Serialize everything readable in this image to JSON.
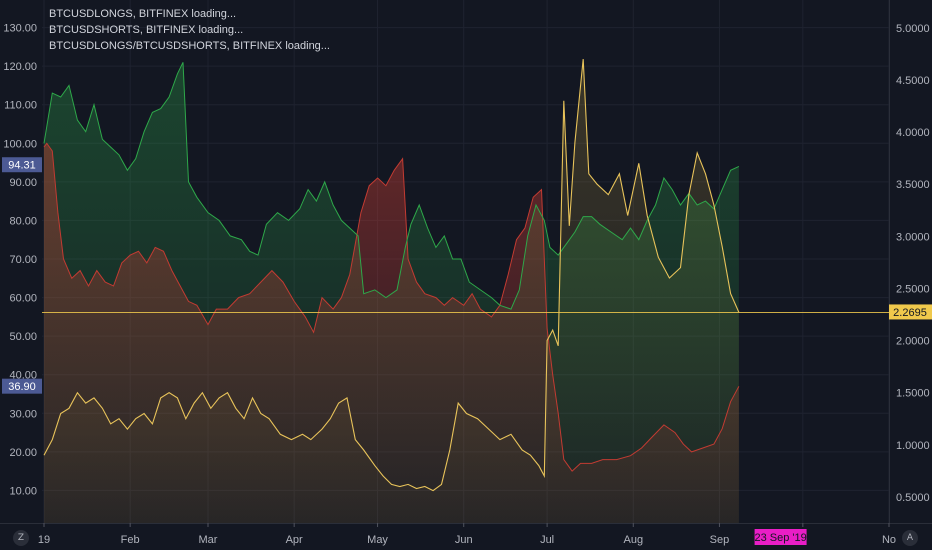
{
  "legend": [
    "BTCUSDLONGS, BITFINEX loading...",
    "BTCUSDSHORTS, BITFINEX loading...",
    "BTCUSDLONGS/BTCUSDSHORTS, BITFINEX loading..."
  ],
  "controls": {
    "left_button": "Z",
    "right_button": "A"
  },
  "colors": {
    "background": "#131722",
    "long_green": "#2ea84a",
    "short_red": "#c23b32",
    "ratio_yellow": "#e8c35a",
    "left_badge": "#4c5a94",
    "right_badge": "#f0c94c",
    "date_badge": "#e91ec6"
  },
  "chart_data": {
    "type": "area",
    "left_axis": {
      "ticks": [
        "130.00",
        "120.00",
        "110.00",
        "100.00",
        "90.00",
        "80.00",
        "70.00",
        "60.00",
        "50.00",
        "40.00",
        "30.00",
        "20.00",
        "10.00"
      ],
      "min": 0,
      "max": 133
    },
    "right_axis": {
      "ticks": [
        "5.0000",
        "4.5000",
        "4.0000",
        "3.5000",
        "3.0000",
        "2.5000",
        "2.0000",
        "1.5000",
        "1.0000",
        "0.5000"
      ],
      "min": 0,
      "max": 5.2
    },
    "x_labels": [
      "19",
      "Feb",
      "Mar",
      "Apr",
      "May",
      "Jun",
      "Jul",
      "Aug",
      "Sep",
      "t",
      "No"
    ],
    "x_dates": [
      "2019-01-01",
      "2019-02-01",
      "2019-03-01",
      "2019-04-01",
      "2019-05-01",
      "2019-06-01",
      "2019-07-01",
      "2019-08-01",
      "2019-09-01",
      "2019-10-01",
      "2019-11-01"
    ],
    "x_range": [
      "2019-01-01",
      "2019-11-01"
    ],
    "crosshair": {
      "date_label": "23 Sep '19",
      "date": "2019-09-23",
      "value_label": "2.2695",
      "value": 2.2695
    },
    "last_value_labels": {
      "longs": "94.31",
      "shorts": "36.90"
    },
    "series": [
      {
        "name": "BTCUSDLONGS",
        "axis": "left",
        "color": "#2ea84a",
        "points": [
          [
            "2019-01-01",
            100
          ],
          [
            "2019-01-04",
            113
          ],
          [
            "2019-01-07",
            112
          ],
          [
            "2019-01-10",
            115
          ],
          [
            "2019-01-13",
            106
          ],
          [
            "2019-01-16",
            103
          ],
          [
            "2019-01-19",
            110
          ],
          [
            "2019-01-22",
            101
          ],
          [
            "2019-01-25",
            99
          ],
          [
            "2019-01-28",
            97
          ],
          [
            "2019-01-31",
            93
          ],
          [
            "2019-02-03",
            96
          ],
          [
            "2019-02-06",
            103
          ],
          [
            "2019-02-09",
            108
          ],
          [
            "2019-02-12",
            109
          ],
          [
            "2019-02-15",
            112
          ],
          [
            "2019-02-18",
            118
          ],
          [
            "2019-02-20",
            121
          ],
          [
            "2019-02-22",
            90
          ],
          [
            "2019-02-25",
            86
          ],
          [
            "2019-03-01",
            82
          ],
          [
            "2019-03-05",
            80
          ],
          [
            "2019-03-09",
            76
          ],
          [
            "2019-03-13",
            75
          ],
          [
            "2019-03-16",
            72
          ],
          [
            "2019-03-19",
            71
          ],
          [
            "2019-03-22",
            79
          ],
          [
            "2019-03-26",
            82
          ],
          [
            "2019-03-30",
            80
          ],
          [
            "2019-04-03",
            83
          ],
          [
            "2019-04-06",
            88
          ],
          [
            "2019-04-09",
            85
          ],
          [
            "2019-04-12",
            90
          ],
          [
            "2019-04-15",
            84
          ],
          [
            "2019-04-18",
            80
          ],
          [
            "2019-04-21",
            78
          ],
          [
            "2019-04-24",
            76
          ],
          [
            "2019-04-26",
            61
          ],
          [
            "2019-04-30",
            62
          ],
          [
            "2019-05-04",
            60
          ],
          [
            "2019-05-08",
            62
          ],
          [
            "2019-05-11",
            73
          ],
          [
            "2019-05-13",
            79
          ],
          [
            "2019-05-16",
            84
          ],
          [
            "2019-05-19",
            78
          ],
          [
            "2019-05-22",
            73
          ],
          [
            "2019-05-25",
            76
          ],
          [
            "2019-05-28",
            70
          ],
          [
            "2019-05-31",
            70
          ],
          [
            "2019-06-03",
            64
          ],
          [
            "2019-06-07",
            62
          ],
          [
            "2019-06-11",
            60
          ],
          [
            "2019-06-14",
            58
          ],
          [
            "2019-06-18",
            57
          ],
          [
            "2019-06-21",
            62
          ],
          [
            "2019-06-24",
            76
          ],
          [
            "2019-06-27",
            84
          ],
          [
            "2019-06-30",
            80
          ],
          [
            "2019-07-02",
            73
          ],
          [
            "2019-07-05",
            71
          ],
          [
            "2019-07-08",
            74
          ],
          [
            "2019-07-11",
            77
          ],
          [
            "2019-07-14",
            81
          ],
          [
            "2019-07-17",
            81
          ],
          [
            "2019-07-20",
            79
          ],
          [
            "2019-07-24",
            77
          ],
          [
            "2019-07-28",
            75
          ],
          [
            "2019-07-31",
            78
          ],
          [
            "2019-08-03",
            75
          ],
          [
            "2019-08-06",
            80
          ],
          [
            "2019-08-09",
            84
          ],
          [
            "2019-08-12",
            91
          ],
          [
            "2019-08-15",
            88
          ],
          [
            "2019-08-18",
            84
          ],
          [
            "2019-08-21",
            87
          ],
          [
            "2019-08-24",
            84
          ],
          [
            "2019-08-27",
            85
          ],
          [
            "2019-08-30",
            83
          ],
          [
            "2019-09-02",
            88
          ],
          [
            "2019-09-05",
            93
          ],
          [
            "2019-09-08",
            94
          ]
        ]
      },
      {
        "name": "BTCUSDSHORTS",
        "axis": "left",
        "color": "#c23b32",
        "points": [
          [
            "2019-01-01",
            99
          ],
          [
            "2019-01-02",
            100
          ],
          [
            "2019-01-04",
            98
          ],
          [
            "2019-01-06",
            82
          ],
          [
            "2019-01-08",
            70
          ],
          [
            "2019-01-11",
            65
          ],
          [
            "2019-01-14",
            67
          ],
          [
            "2019-01-17",
            63
          ],
          [
            "2019-01-20",
            67
          ],
          [
            "2019-01-23",
            64
          ],
          [
            "2019-01-26",
            63
          ],
          [
            "2019-01-29",
            69
          ],
          [
            "2019-02-01",
            71
          ],
          [
            "2019-02-04",
            72
          ],
          [
            "2019-02-07",
            69
          ],
          [
            "2019-02-10",
            73
          ],
          [
            "2019-02-13",
            72
          ],
          [
            "2019-02-16",
            67
          ],
          [
            "2019-02-19",
            63
          ],
          [
            "2019-02-22",
            59
          ],
          [
            "2019-02-25",
            58
          ],
          [
            "2019-03-01",
            53
          ],
          [
            "2019-03-04",
            57
          ],
          [
            "2019-03-08",
            57
          ],
          [
            "2019-03-12",
            60
          ],
          [
            "2019-03-16",
            61
          ],
          [
            "2019-03-20",
            64
          ],
          [
            "2019-03-24",
            67
          ],
          [
            "2019-03-28",
            64
          ],
          [
            "2019-04-01",
            59
          ],
          [
            "2019-04-05",
            55
          ],
          [
            "2019-04-08",
            51
          ],
          [
            "2019-04-11",
            60
          ],
          [
            "2019-04-15",
            57
          ],
          [
            "2019-04-18",
            60
          ],
          [
            "2019-04-21",
            66
          ],
          [
            "2019-04-25",
            82
          ],
          [
            "2019-04-28",
            89
          ],
          [
            "2019-05-01",
            91
          ],
          [
            "2019-05-04",
            89
          ],
          [
            "2019-05-07",
            93
          ],
          [
            "2019-05-10",
            96
          ],
          [
            "2019-05-12",
            70
          ],
          [
            "2019-05-15",
            64
          ],
          [
            "2019-05-18",
            61
          ],
          [
            "2019-05-22",
            60
          ],
          [
            "2019-05-25",
            58
          ],
          [
            "2019-05-28",
            60
          ],
          [
            "2019-06-01",
            58
          ],
          [
            "2019-06-04",
            61
          ],
          [
            "2019-06-07",
            57
          ],
          [
            "2019-06-11",
            55
          ],
          [
            "2019-06-14",
            58
          ],
          [
            "2019-06-17",
            66
          ],
          [
            "2019-06-20",
            75
          ],
          [
            "2019-06-23",
            78
          ],
          [
            "2019-06-26",
            86
          ],
          [
            "2019-06-29",
            88
          ],
          [
            "2019-07-01",
            52
          ],
          [
            "2019-07-03",
            40
          ],
          [
            "2019-07-05",
            30
          ],
          [
            "2019-07-07",
            18
          ],
          [
            "2019-07-10",
            15
          ],
          [
            "2019-07-13",
            17
          ],
          [
            "2019-07-17",
            17
          ],
          [
            "2019-07-21",
            18
          ],
          [
            "2019-07-26",
            18
          ],
          [
            "2019-07-31",
            19
          ],
          [
            "2019-08-04",
            21
          ],
          [
            "2019-08-08",
            24
          ],
          [
            "2019-08-12",
            27
          ],
          [
            "2019-08-16",
            25
          ],
          [
            "2019-08-19",
            22
          ],
          [
            "2019-08-22",
            20
          ],
          [
            "2019-08-26",
            21
          ],
          [
            "2019-08-30",
            22
          ],
          [
            "2019-09-02",
            26
          ],
          [
            "2019-09-05",
            33
          ],
          [
            "2019-09-08",
            37
          ]
        ]
      },
      {
        "name": "BTCUSDLONGS/BTCUSDSHORTS",
        "axis": "right",
        "color": "#e8c35a",
        "points": [
          [
            "2019-01-01",
            0.9
          ],
          [
            "2019-01-04",
            1.05
          ],
          [
            "2019-01-07",
            1.3
          ],
          [
            "2019-01-10",
            1.35
          ],
          [
            "2019-01-13",
            1.5
          ],
          [
            "2019-01-16",
            1.4
          ],
          [
            "2019-01-19",
            1.45
          ],
          [
            "2019-01-22",
            1.35
          ],
          [
            "2019-01-25",
            1.2
          ],
          [
            "2019-01-28",
            1.25
          ],
          [
            "2019-01-31",
            1.15
          ],
          [
            "2019-02-03",
            1.25
          ],
          [
            "2019-02-06",
            1.3
          ],
          [
            "2019-02-09",
            1.2
          ],
          [
            "2019-02-12",
            1.45
          ],
          [
            "2019-02-15",
            1.5
          ],
          [
            "2019-02-18",
            1.45
          ],
          [
            "2019-02-21",
            1.25
          ],
          [
            "2019-02-24",
            1.4
          ],
          [
            "2019-02-27",
            1.5
          ],
          [
            "2019-03-02",
            1.35
          ],
          [
            "2019-03-05",
            1.45
          ],
          [
            "2019-03-08",
            1.5
          ],
          [
            "2019-03-11",
            1.35
          ],
          [
            "2019-03-14",
            1.25
          ],
          [
            "2019-03-17",
            1.45
          ],
          [
            "2019-03-20",
            1.3
          ],
          [
            "2019-03-23",
            1.25
          ],
          [
            "2019-03-27",
            1.1
          ],
          [
            "2019-03-31",
            1.05
          ],
          [
            "2019-04-04",
            1.1
          ],
          [
            "2019-04-07",
            1.05
          ],
          [
            "2019-04-11",
            1.15
          ],
          [
            "2019-04-14",
            1.25
          ],
          [
            "2019-04-17",
            1.4
          ],
          [
            "2019-04-20",
            1.45
          ],
          [
            "2019-04-23",
            1.05
          ],
          [
            "2019-04-26",
            0.95
          ],
          [
            "2019-04-30",
            0.8
          ],
          [
            "2019-05-03",
            0.7
          ],
          [
            "2019-05-06",
            0.62
          ],
          [
            "2019-05-09",
            0.6
          ],
          [
            "2019-05-12",
            0.62
          ],
          [
            "2019-05-15",
            0.58
          ],
          [
            "2019-05-18",
            0.6
          ],
          [
            "2019-05-21",
            0.56
          ],
          [
            "2019-05-24",
            0.62
          ],
          [
            "2019-05-27",
            0.95
          ],
          [
            "2019-05-30",
            1.4
          ],
          [
            "2019-06-02",
            1.3
          ],
          [
            "2019-06-06",
            1.25
          ],
          [
            "2019-06-10",
            1.15
          ],
          [
            "2019-06-14",
            1.05
          ],
          [
            "2019-06-18",
            1.1
          ],
          [
            "2019-06-22",
            0.95
          ],
          [
            "2019-06-25",
            0.9
          ],
          [
            "2019-06-28",
            0.8
          ],
          [
            "2019-06-30",
            0.7
          ],
          [
            "2019-07-01",
            2.0
          ],
          [
            "2019-07-03",
            2.1
          ],
          [
            "2019-07-05",
            1.95
          ],
          [
            "2019-07-07",
            4.3
          ],
          [
            "2019-07-09",
            3.1
          ],
          [
            "2019-07-11",
            3.9
          ],
          [
            "2019-07-14",
            4.7
          ],
          [
            "2019-07-16",
            3.6
          ],
          [
            "2019-07-19",
            3.5
          ],
          [
            "2019-07-23",
            3.4
          ],
          [
            "2019-07-27",
            3.6
          ],
          [
            "2019-07-30",
            3.2
          ],
          [
            "2019-08-03",
            3.7
          ],
          [
            "2019-08-06",
            3.2
          ],
          [
            "2019-08-10",
            2.8
          ],
          [
            "2019-08-14",
            2.6
          ],
          [
            "2019-08-18",
            2.7
          ],
          [
            "2019-08-21",
            3.4
          ],
          [
            "2019-08-24",
            3.8
          ],
          [
            "2019-08-27",
            3.6
          ],
          [
            "2019-08-30",
            3.3
          ],
          [
            "2019-09-02",
            2.9
          ],
          [
            "2019-09-05",
            2.45
          ],
          [
            "2019-09-08",
            2.27
          ]
        ]
      }
    ]
  }
}
